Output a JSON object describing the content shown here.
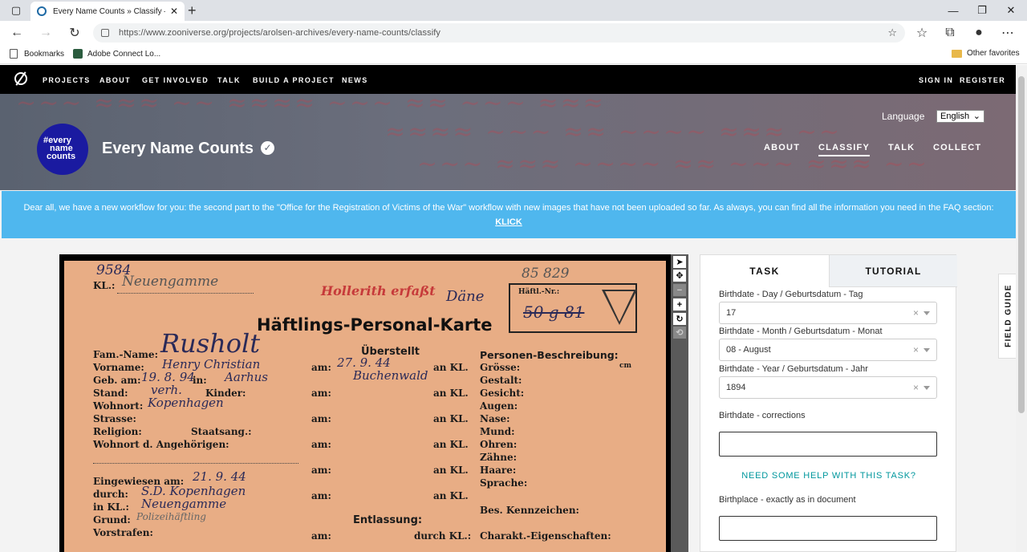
{
  "browser": {
    "tab_title": "Every Name Counts » Classify —",
    "url": "https://www.zooniverse.org/projects/arolsen-archives/every-name-counts/classify",
    "bookmarks": [
      "Bookmarks",
      "Adobe Connect Lo..."
    ],
    "other_favorites": "Other favorites"
  },
  "topnav": {
    "links": [
      "PROJECTS",
      "ABOUT",
      "GET INVOLVED",
      "TALK",
      "BUILD A PROJECT",
      "NEWS"
    ],
    "sign_in": "SIGN IN",
    "register": "REGISTER"
  },
  "project": {
    "logo_text": [
      "#every",
      "name",
      "counts"
    ],
    "title": "Every Name Counts",
    "language_label": "Language",
    "language_value": "English",
    "nav": [
      "ABOUT",
      "CLASSIFY",
      "TALK",
      "COLLECT"
    ]
  },
  "banner": {
    "text": "Dear all, we have a new workflow for you: the second part to the \"Office for the Registration of Victims of the War\" workflow with new images that have not been uploaded so far. As always, you can find all the information you need in the FAQ section:",
    "link": "KLICK"
  },
  "card": {
    "number_left": "9584",
    "kl_label": "KL.:",
    "kl_value": "Neuengamme",
    "stamp": "Hollerith erfaßt",
    "dane": "Däne",
    "number_right": "85 829",
    "haftl_nr": "Häftl.-Nr.:",
    "haftl_value": "50 g 81",
    "title": "Häftlings-Personal-Karte",
    "fam_label": "Fam.-Name:",
    "fam_value": "Rusholt",
    "vor_label": "Vorname:",
    "vor_value": "Henry Christian",
    "geb_label": "Geb. am:",
    "geb_value": "19. 8. 94",
    "in_label": "in:",
    "in_value": "Aarhus",
    "stand_label": "Stand:",
    "stand_value": "verh.",
    "kinder_label": "Kinder:",
    "wohn_label": "Wohnort:",
    "wohn_value": "Kopenhagen",
    "strasse_label": "Strasse:",
    "religion_label": "Religion:",
    "staatsang_label": "Staatsang.:",
    "wohnort_ang": "Wohnort d. Angehörigen:",
    "eingew_label": "Eingewiesen am:",
    "eingew_value": "21. 9. 44",
    "durch_label": "durch:",
    "durch_value": "S.D. Kopenhagen",
    "inkl_label": "in KL.:",
    "inkl_value": "Neuengamme",
    "grund_label": "Grund:",
    "grund_value": "Polizeihäftling",
    "vorstrafen_label": "Vorstrafen:",
    "ueberstellt": "Überstellt",
    "am_label": "am:",
    "am_value": "27. 9. 44",
    "ankl": "an KL.",
    "buch_value": "Buchenwald",
    "entlassung": "Entlassung:",
    "durch_kl": "durch KL.:",
    "personen": "Personen-Beschreibung:",
    "desc": [
      "Grösse:",
      "Gestalt:",
      "Gesicht:",
      "Augen:",
      "Nase:",
      "Mund:",
      "Ohren:",
      "Zähne:",
      "Haare:",
      "Sprache:"
    ],
    "cm": "cm",
    "bes": "Bes. Kennzeichen:",
    "charakt": "Charakt.-Eigenschaften:"
  },
  "panel": {
    "tab_task": "TASK",
    "tab_tutorial": "TUTORIAL",
    "day_label": "Birthdate - Day / Geburtsdatum - Tag",
    "day_value": "17",
    "month_label": "Birthdate - Month / Geburtsdatum - Monat",
    "month_value": "08 - August",
    "year_label": "Birthdate - Year / Geburtsdatum - Jahr",
    "year_value": "1894",
    "corrections_label": "Birthdate - corrections",
    "help": "NEED SOME HELP WITH THIS TASK?",
    "birthplace_label": "Birthplace - exactly as in document"
  },
  "field_guide": "FIELD GUIDE"
}
